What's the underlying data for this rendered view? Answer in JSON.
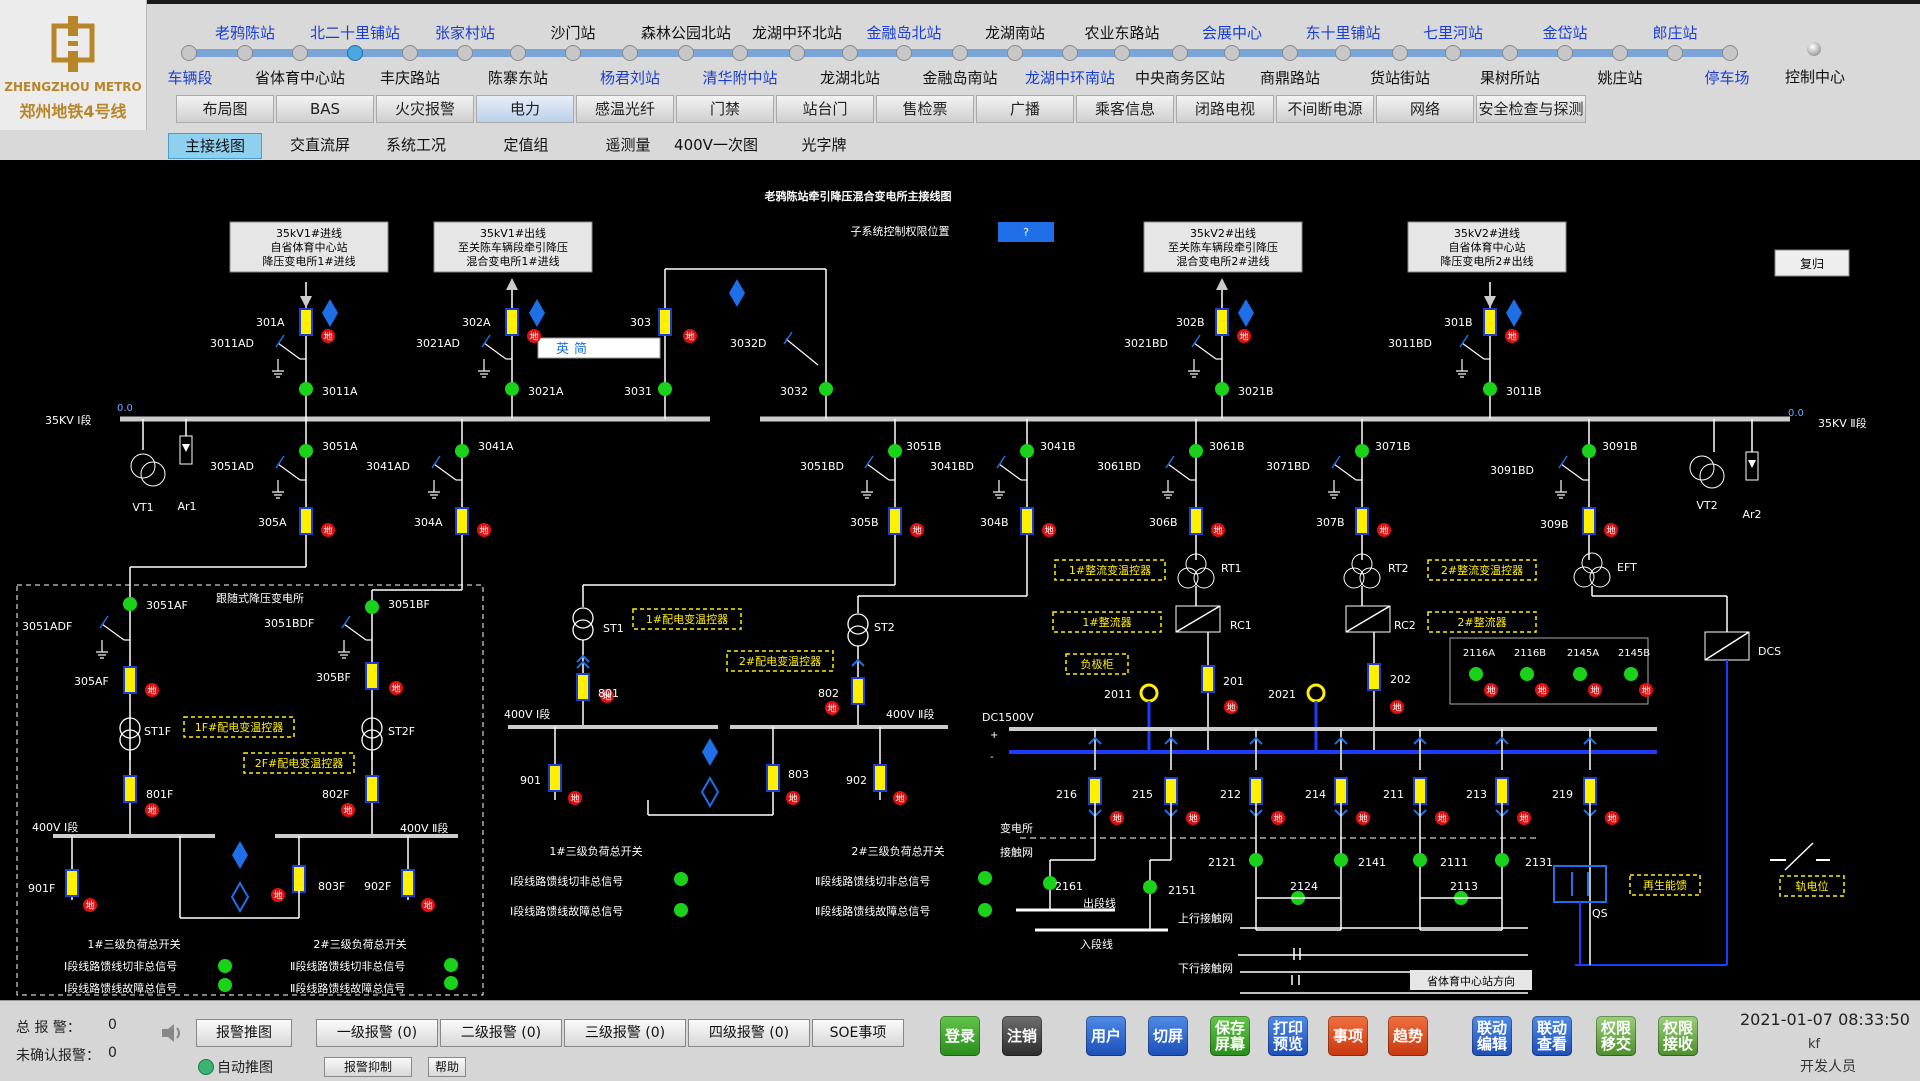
{
  "app": {
    "logo_title": "郑州地铁4号线",
    "logo_sub": "ZHENGZHOU METRO"
  },
  "stations_top": [
    {
      "label": "老鸦陈站",
      "color": "blue"
    },
    {
      "label": "北二十里铺站",
      "color": "blue"
    },
    {
      "label": "张家村站",
      "color": "blue"
    },
    {
      "label": "沙门站",
      "color": "dark"
    },
    {
      "label": "森林公园北站",
      "color": "dark"
    },
    {
      "label": "龙湖中环北站",
      "color": "dark"
    },
    {
      "label": "金融岛北站",
      "color": "blue"
    },
    {
      "label": "龙湖南站",
      "color": "dark"
    },
    {
      "label": "农业东路站",
      "color": "dark"
    },
    {
      "label": "会展中心",
      "color": "blue"
    },
    {
      "label": "东十里铺站",
      "color": "blue"
    },
    {
      "label": "七里河站",
      "color": "blue"
    },
    {
      "label": "金岱站",
      "color": "blue"
    },
    {
      "label": "郎庄站",
      "color": "blue"
    }
  ],
  "stations_bottom": [
    {
      "label": "车辆段",
      "color": "blue"
    },
    {
      "label": "省体育中心站",
      "color": "dark"
    },
    {
      "label": "丰庆路站",
      "color": "dark"
    },
    {
      "label": "陈寨东站",
      "color": "dark"
    },
    {
      "label": "杨君刘站",
      "color": "blue"
    },
    {
      "label": "清华附中站",
      "color": "blue"
    },
    {
      "label": "龙湖北站",
      "color": "dark"
    },
    {
      "label": "金融岛南站",
      "color": "dark"
    },
    {
      "label": "龙湖中环南站",
      "color": "blue"
    },
    {
      "label": "中央商务区站",
      "color": "dark"
    },
    {
      "label": "商鼎路站",
      "color": "dark"
    },
    {
      "label": "货站街站",
      "color": "dark"
    },
    {
      "label": "果树所站",
      "color": "dark"
    },
    {
      "label": "姚庄站",
      "color": "dark"
    },
    {
      "label": "停车场",
      "color": "blue"
    }
  ],
  "control_center": "控制中心",
  "tabs": [
    "布局图",
    "BAS",
    "火灾报警",
    "电力",
    "感温光纤",
    "门禁",
    "站台门",
    "售检票",
    "广播",
    "乘客信息",
    "闭路电视",
    "不间断电源",
    "网络",
    "安全检查与探测"
  ],
  "active_tab": "电力",
  "subtabs": [
    "主接线图",
    "交直流屏",
    "系统工况",
    "定值组",
    "遥测量",
    "400V一次图",
    "光字牌"
  ],
  "active_subtab": "主接线图",
  "diagram": {
    "title": "老鸦陈站牵引降压混合变电所主接线图",
    "perm_label": "子系统控制权限位置",
    "perm_value": "?",
    "reset": "复归",
    "boxes": {
      "in1": [
        "35kV1#进线",
        "自省体育中心站",
        "降压变电所1#进线"
      ],
      "out1": [
        "35kV1#出线",
        "至关陈车辆段牵引降压",
        "混合变电所1#进线"
      ],
      "out2": [
        "35kV2#出线",
        "至关陈车辆段牵引降压",
        "混合变电所2#进线"
      ],
      "in2": [
        "35kV2#进线",
        "自省体育中心站",
        "降压变电所2#出线"
      ]
    },
    "bus1": "35KV Ⅰ段",
    "bus2": "35KV Ⅱ段",
    "bus_val1": "0.0",
    "bus_val2": "0.0",
    "ime": [
      "英",
      "简"
    ],
    "ground": "地",
    "labels": {
      "s301A": "301A",
      "s3011AD": "3011AD",
      "s3011A": "3011A",
      "s302A": "302A",
      "s3021AD": "3021AD",
      "s3021A": "3021A",
      "s303": "303",
      "s3031": "3031",
      "s3032D": "3032D",
      "s3032": "3032",
      "s302B": "302B",
      "s3021BD": "3021BD",
      "s3021B": "3021B",
      "s301B": "301B",
      "s3011BD": "3011BD",
      "s3011B": "3011B",
      "s3051A": "3051A",
      "s3051AD": "3051AD",
      "s305A": "305A",
      "s3041A": "3041A",
      "s3041AD": "3041AD",
      "s304A": "304A",
      "vt1": "VT1",
      "ar1": "Ar1",
      "vt2": "VT2",
      "ar2": "Ar2",
      "s3051B": "3051B",
      "s3051BD": "3051BD",
      "s305B": "305B",
      "s3041B": "3041B",
      "s3041BD": "3041BD",
      "s304B": "304B",
      "s3061B": "3061B",
      "s3061BD": "3061BD",
      "s306B": "306B",
      "s3071B": "3071B",
      "s3071BD": "3071BD",
      "s307B": "307B",
      "s3091B": "3091B",
      "s3091BD": "3091BD",
      "s309B": "309B",
      "rt1": "RT1",
      "rt2": "RT2",
      "eft": "EFT",
      "rc1": "RC1",
      "rc2": "RC2",
      "dcs": "DCS",
      "s201": "201",
      "s202": "202",
      "s2011": "2011",
      "s2021": "2021",
      "dc": "DC1500V",
      "plus": "+",
      "minus": "-",
      "s216": "216",
      "s215": "215",
      "s212": "212",
      "s214": "214",
      "s211": "211",
      "s213": "213",
      "s219": "219",
      "s2121": "2121",
      "s2141": "2141",
      "s2111": "2111",
      "s2131": "2131",
      "s2124": "2124",
      "s2113": "2113",
      "s2161": "2161",
      "s2151": "2151",
      "sub_station": "变电所",
      "sub_net": "接触网",
      "out_line": "出段线",
      "in_line": "入段线",
      "up_net": "上行接触网",
      "down_net": "下行接触网",
      "dir": "省体育中心站方向",
      "qs": "QS",
      "regen": "再生能馈",
      "rail": "轨电位",
      "s2116A": "2116A",
      "s2116B": "2116B",
      "s2145A": "2145A",
      "s2145B": "2145B",
      "st1": "ST1",
      "st2": "ST2",
      "s801": "801",
      "s802": "802",
      "b400_1": "400V Ⅰ段",
      "b400_2": "400V Ⅱ段",
      "s901": "901",
      "s902": "902",
      "s803": "803",
      "ld1": "1#三级负荷总开关",
      "ld2": "2#三级负荷总开关",
      "fd_cut1": "Ⅰ段线路馈线切非总信号",
      "fd_flt1": "Ⅰ段线路馈线故障总信号",
      "fd_cut2": "Ⅱ段线路馈线切非总信号",
      "fd_flt2": "Ⅱ段线路馈线故障总信号",
      "follow": "跟随式降压变电所",
      "s3051AF": "3051AF",
      "s3051ADF": "3051ADF",
      "s305AF": "305AF",
      "s3051BF": "3051BF",
      "s3051BDF": "3051BDF",
      "s305BF": "305BF",
      "st1f": "ST1F",
      "st2f": "ST2F",
      "s801F": "801F",
      "s802F": "802F",
      "b400_1f": "400V Ⅰ段",
      "b400_2f": "400V Ⅱ段",
      "s901F": "901F",
      "s902F": "902F",
      "s803F": "803F",
      "ld1f": "1#三级负荷总开关",
      "ld2f": "2#三级负荷总开关",
      "fd_cut1f": "Ⅰ段线路馈线切非总信号",
      "fd_flt1f": "Ⅰ段线路馈线故障总信号",
      "fd_cut2f": "Ⅱ段线路馈线切非总信号",
      "fd_flt2f": "Ⅱ段线路馈线故障总信号"
    },
    "ctrl_tags": {
      "rt1": "1#整流变温控器",
      "rect1": "1#整流器",
      "neg": "负极柜",
      "rt2": "2#整流变温控器",
      "rect2": "2#整流器",
      "st1": "1#配电变温控器",
      "st2": "2#配电变温控器",
      "st1f": "1F#配电变温控器",
      "st2f": "2F#配电变温控器"
    }
  },
  "footer": {
    "total_alarm_label": "总 报 警：",
    "total_alarm_value": "0",
    "unack_label": "未确认报警：",
    "unack_value": "0",
    "alarm_push": "报警推图",
    "auto_push": "自动推图",
    "level1": "一级报警 (0)",
    "level2": "二级报警 (0)",
    "level3": "三级报警 (0)",
    "level4": "四级报警 (0)",
    "soe": "SOE事项",
    "suppress": "报警抑制",
    "help": "帮助",
    "login": "登录",
    "logout": "注销",
    "user_btn": "用户",
    "switch_screen": "切屏",
    "save_screen": [
      "保存",
      "屏幕"
    ],
    "print_preview": [
      "打印",
      "预览"
    ],
    "events": "事项",
    "trend": "趋势",
    "link_edit": [
      "联动",
      "编辑"
    ],
    "link_view": [
      "联动",
      "查看"
    ],
    "perm_transfer": [
      "权限",
      "移交"
    ],
    "perm_receive": [
      "权限",
      "接收"
    ],
    "datetime": "2021-01-07 08:33:50",
    "user": "kf",
    "role": "开发人员"
  }
}
